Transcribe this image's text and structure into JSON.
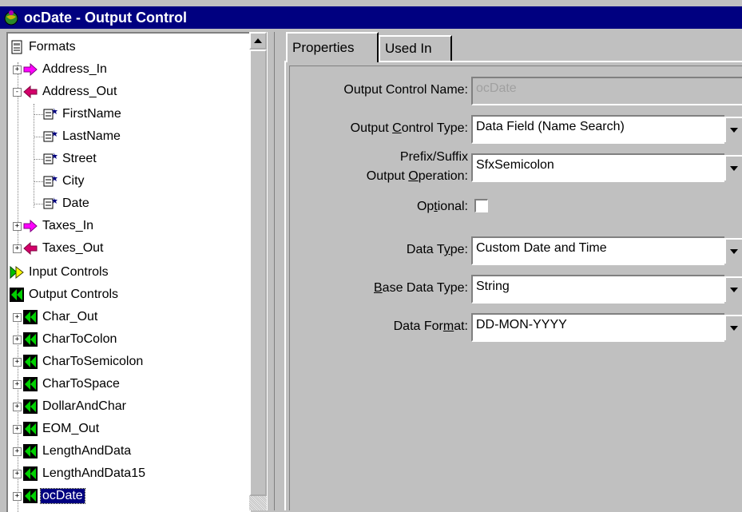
{
  "window": {
    "title": "ocDate - Output Control"
  },
  "tree": {
    "root": {
      "label": "Formats",
      "icon": "formats-document-icon"
    },
    "formats": [
      {
        "label": "Address_In",
        "icon": "input-arrow-icon",
        "expander": "+"
      },
      {
        "label": "Address_Out",
        "icon": "output-arrow-icon",
        "expander": "-"
      },
      {
        "label": "FirstName",
        "icon": "field-icon"
      },
      {
        "label": "LastName",
        "icon": "field-icon"
      },
      {
        "label": "Street",
        "icon": "field-icon"
      },
      {
        "label": "City",
        "icon": "field-icon"
      },
      {
        "label": "Date",
        "icon": "field-icon"
      },
      {
        "label": "Taxes_In",
        "icon": "input-arrow-icon",
        "expander": "+"
      },
      {
        "label": "Taxes_Out",
        "icon": "output-arrow-icon",
        "expander": "+"
      }
    ],
    "input_controls": {
      "label": "Input Controls",
      "icon": "input-controls-icon"
    },
    "output_controls": {
      "label": "Output Controls",
      "icon": "output-controls-icon"
    },
    "output_items": [
      {
        "label": "Char_Out",
        "expander": "+"
      },
      {
        "label": "CharToColon",
        "expander": "+"
      },
      {
        "label": "CharToSemicolon",
        "expander": "+"
      },
      {
        "label": "CharToSpace",
        "expander": "+"
      },
      {
        "label": "DollarAndChar",
        "expander": "+"
      },
      {
        "label": "EOM_Out",
        "expander": "+"
      },
      {
        "label": "LengthAndData",
        "expander": "+"
      },
      {
        "label": "LengthAndData15",
        "expander": "+"
      },
      {
        "label": "ocDate",
        "expander": "+",
        "selected": true
      }
    ]
  },
  "tabs": [
    {
      "label": "Properties",
      "active": true
    },
    {
      "label": "Used In",
      "active": false
    }
  ],
  "form": {
    "name_label": "Output Control Name:",
    "name_value": "ocDate",
    "type_label": {
      "pre": "Output ",
      "mn": "C",
      "post": "ontrol Type:"
    },
    "type_value": "Data Field (Name Search)",
    "prefix_label_line1": "Prefix/Suffix",
    "prefix_label_line2": {
      "pre": "Output ",
      "mn": "O",
      "post": "peration:"
    },
    "prefix_value": "SfxSemicolon",
    "optional_label": {
      "pre": "Op",
      "mn": "t",
      "post": "ional:"
    },
    "optional_checked": false,
    "datatype_label": {
      "pre": "Data T",
      "mn": "y",
      "post": "pe:"
    },
    "datatype_value": "Custom Date and Time",
    "basetype_label": {
      "pre": "",
      "mn": "B",
      "post": "ase Data Type:"
    },
    "basetype_value": "String",
    "format_label": {
      "pre": "Data For",
      "mn": "m",
      "post": "at:"
    },
    "format_value": "DD-MON-YYYY"
  },
  "colors": {
    "title_bar": "#000080",
    "selection": "#000080",
    "face": "#c0c0c0",
    "input_arrow": "#ff00ff",
    "output_arrow": "#d4006a",
    "output_controls_green": "#008000"
  }
}
